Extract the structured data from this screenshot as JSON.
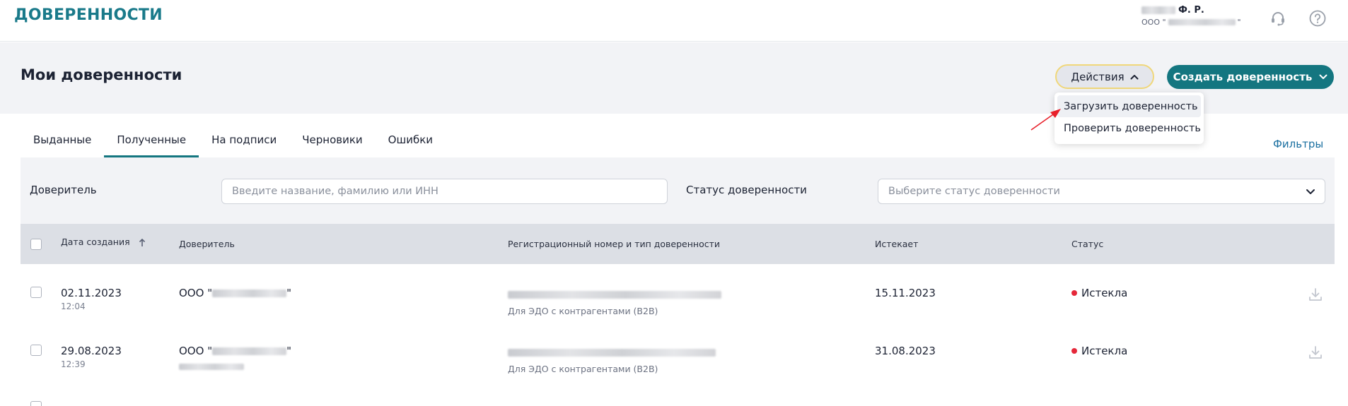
{
  "app": {
    "title": "ДОВЕРЕННОСТИ"
  },
  "user": {
    "name_suffix": "Ф. Р.",
    "org_prefix": "ООО \"",
    "org_suffix": "\""
  },
  "page": {
    "title": "Мои доверенности"
  },
  "actions": {
    "label": "Действия",
    "create_label": "Создать доверенность",
    "menu": [
      "Загрузить доверенность",
      "Проверить доверенность"
    ]
  },
  "tabs": [
    "Выданные",
    "Полученные",
    "На подписи",
    "Черновики",
    "Ошибки"
  ],
  "active_tab": "Полученные",
  "filters_link": "Фильтры",
  "filters": {
    "principal_label": "Доверитель",
    "principal_placeholder": "Введите название, фамилию или ИНН",
    "status_label": "Статус доверенности",
    "status_placeholder": "Выберите статус доверенности"
  },
  "table": {
    "columns": [
      "Дата создания",
      "Доверитель",
      "Регистрационный номер и тип доверенности",
      "Истекает",
      "Статус"
    ],
    "rows": [
      {
        "date": "02.11.2023",
        "time": "12:04",
        "principal_prefix": "ООО \"",
        "principal_suffix": "\"",
        "type": "Для ЭДО с контрагентами (B2B)",
        "expires": "15.11.2023",
        "status": "Истекла"
      },
      {
        "date": "29.08.2023",
        "time": "12:39",
        "principal_prefix": "ООО \"",
        "principal_suffix": "\"",
        "type": "Для ЭДО с контрагентами (B2B)",
        "expires": "31.08.2023",
        "status": "Истекла"
      }
    ]
  },
  "colors": {
    "brand": "#147680",
    "title": "#1a7a8a",
    "link": "#1a6fa0",
    "status_expired": "#e5283a"
  },
  "icons": [
    "support-headset-icon",
    "help-icon",
    "chevron-up-icon",
    "chevron-down-icon",
    "sort-arrow-up-icon",
    "download-icon"
  ]
}
